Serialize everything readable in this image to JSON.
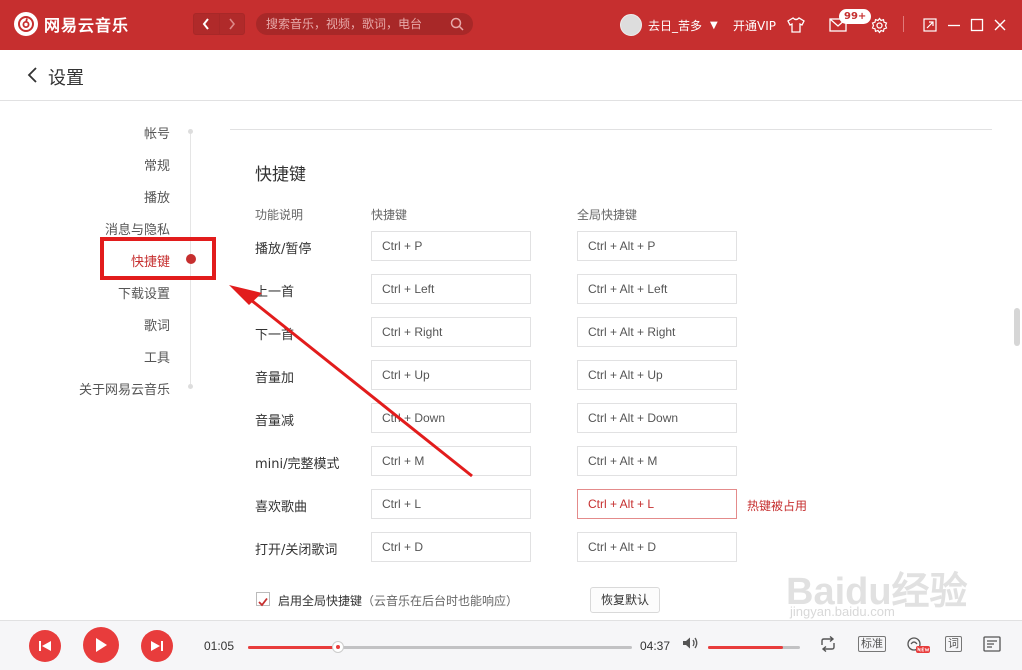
{
  "app": {
    "name": "网易云音乐",
    "search_placeholder": "搜索音乐，视频，歌词，电台",
    "user_name": "去日_苦多",
    "vip_label": "开通VIP",
    "message_badge": "99+"
  },
  "header": {
    "title": "设置"
  },
  "sidebar": {
    "items": [
      {
        "label": "帐号"
      },
      {
        "label": "常规"
      },
      {
        "label": "播放"
      },
      {
        "label": "消息与隐私"
      },
      {
        "label": "快捷键"
      },
      {
        "label": "下载设置"
      },
      {
        "label": "歌词"
      },
      {
        "label": "工具"
      },
      {
        "label": "关于网易云音乐"
      }
    ],
    "active_index": 4
  },
  "shortcuts": {
    "title": "快捷键",
    "col_function": "功能说明",
    "col_shortcut": "快捷键",
    "col_global": "全局快捷键",
    "rows": [
      {
        "label": "播放/暂停",
        "local": "Ctrl + P",
        "global": "Ctrl + Alt + P"
      },
      {
        "label": "上一首",
        "local": "Ctrl + Left",
        "global": "Ctrl + Alt + Left"
      },
      {
        "label": "下一首",
        "local": "Ctrl + Right",
        "global": "Ctrl + Alt + Right"
      },
      {
        "label": "音量加",
        "local": "Ctrl + Up",
        "global": "Ctrl + Alt + Up"
      },
      {
        "label": "音量减",
        "local": "Ctrl + Down",
        "global": "Ctrl + Alt + Down"
      },
      {
        "label": "mini/完整模式",
        "local": "Ctrl + M",
        "global": "Ctrl + Alt + M"
      },
      {
        "label": "喜欢歌曲",
        "local": "Ctrl + L",
        "global": "Ctrl + Alt + L"
      },
      {
        "label": "打开/关闭歌词",
        "local": "Ctrl + D",
        "global": "Ctrl + Alt + D"
      }
    ],
    "conflict_message": "热键被占用",
    "enable_global_label": "启用全局快捷键",
    "enable_global_hint": "（云音乐在后台时也能响应）",
    "enable_global_checked": true,
    "restore_label": "恢复默认"
  },
  "player": {
    "current_time": "01:05",
    "total_time": "04:37",
    "progress": 0.235,
    "volume": 0.82,
    "quality_label": "标准",
    "lyrics_label": "词"
  },
  "watermark": {
    "text": "Baidu经验",
    "sub": "jingyan.baidu.com"
  },
  "colors": {
    "brand": "#c62f2f",
    "accent": "#e83c3c",
    "annotation": "#e21c1c"
  }
}
